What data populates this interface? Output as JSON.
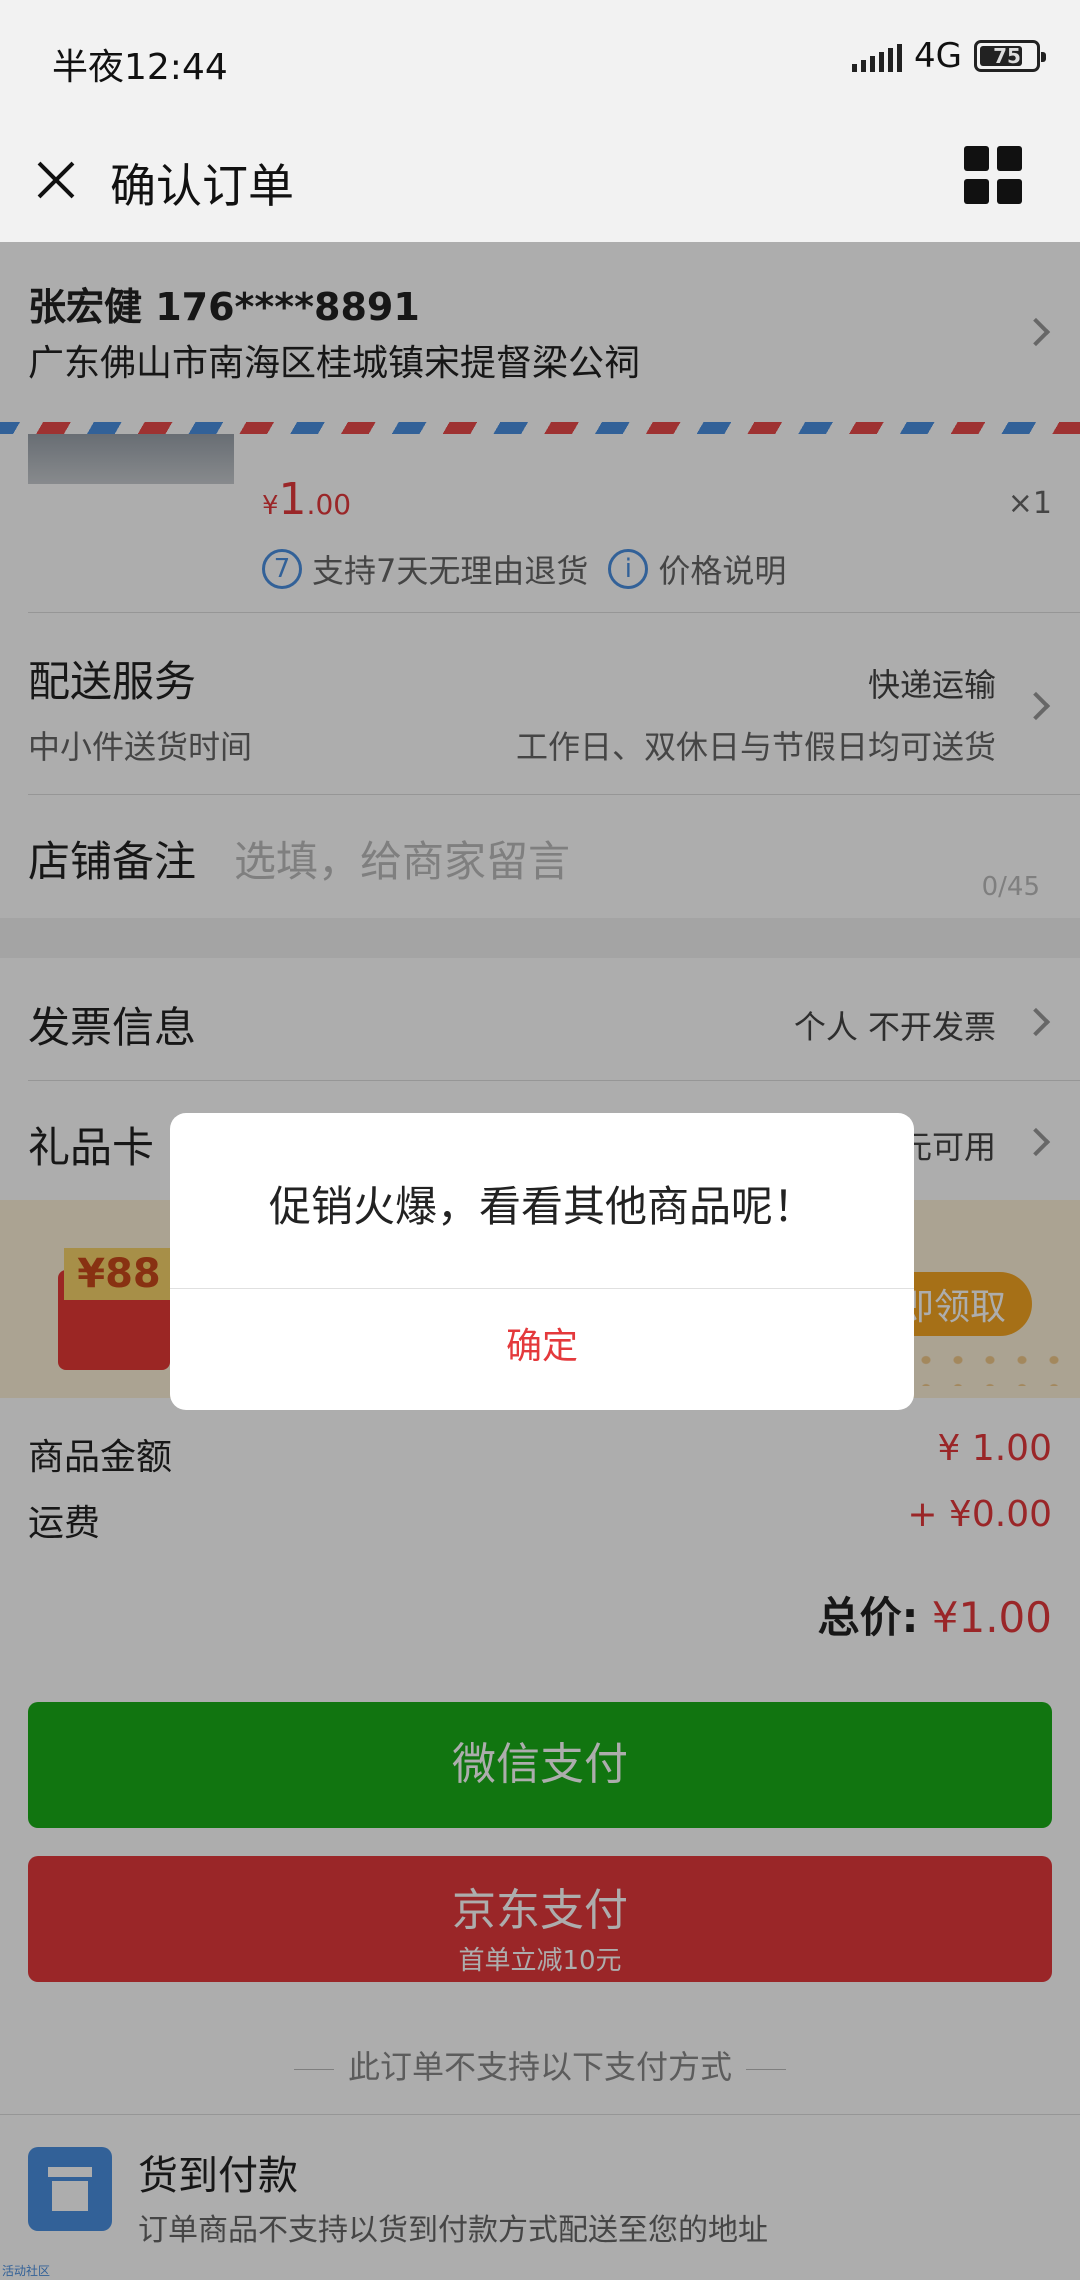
{
  "status_bar": {
    "time": "半夜12:44",
    "network": "4G",
    "battery": "75"
  },
  "nav": {
    "title": "确认订单"
  },
  "address": {
    "name_phone": "张宏健 176****8891",
    "line": "广东佛山市南海区桂城镇宋提督梁公祠"
  },
  "product": {
    "price_symbol": "¥",
    "price_int": "1",
    "price_dec": ".00",
    "qty": "×1",
    "return_icon": "7",
    "return_text": "支持7天无理由退货",
    "info_icon": "i",
    "price_note": "价格说明"
  },
  "delivery": {
    "title": "配送服务",
    "value": "快递运输",
    "sub_left": "中小件送货时间",
    "sub_right": "工作日、双休日与节假日均可送货"
  },
  "remark": {
    "title": "店铺备注",
    "placeholder": "选填，给商家留言",
    "count": "0/45"
  },
  "invoice": {
    "title": "发票信息",
    "value": "个人 不开发票"
  },
  "gift_card": {
    "title": "礼品卡",
    "value": "元可用"
  },
  "coupon": {
    "tag": "¥88",
    "button": "即领取"
  },
  "summary": {
    "goods_label": "商品金额",
    "goods_value": "¥ 1.00",
    "shipping_label": "运费",
    "shipping_value": "+ ¥0.00",
    "total_label": "总价:",
    "total_value": "¥1.00"
  },
  "payment": {
    "wechat": "微信支付",
    "jd": "京东支付",
    "jd_sub": "首单立减10元",
    "unsupported_note": "此订单不支持以下支付方式"
  },
  "cod": {
    "title": "货到付款",
    "desc": "订单商品不支持以货到付款方式配送至您的地址"
  },
  "dialog": {
    "message": "促销火爆，看看其他商品呢！",
    "confirm": "确定"
  },
  "footer": {
    "text": "活动社区"
  }
}
